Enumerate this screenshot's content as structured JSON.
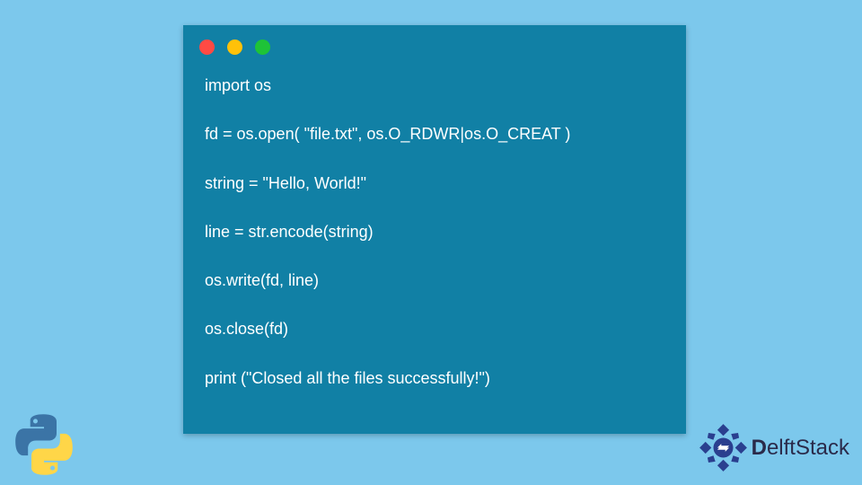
{
  "code": {
    "lines": [
      "import os",
      "fd = os.open( \"file.txt\", os.O_RDWR|os.O_CREAT )",
      "string = \"Hello, World!\"",
      "line = str.encode(string)",
      "os.write(fd, line)",
      "os.close(fd)",
      "print (\"Closed all the files successfully!\")"
    ]
  },
  "brand": {
    "name_bold": "D",
    "name_rest": "elftStack"
  }
}
